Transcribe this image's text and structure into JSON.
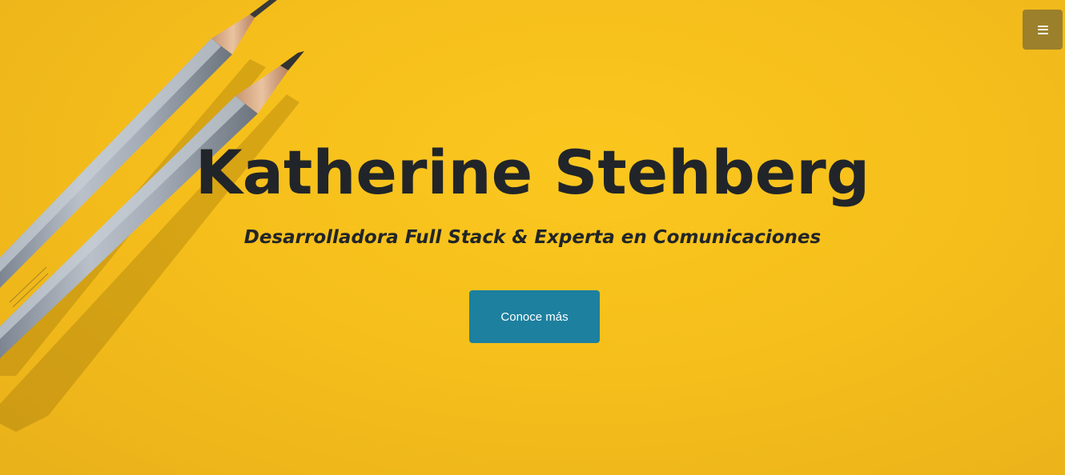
{
  "hero": {
    "title": "Katherine Stehberg",
    "subtitle": "Desarrolladora Full Stack & Experta en Comunicaciones",
    "cta_label": "Conoce más",
    "background_color": "#f6bf1b"
  },
  "nav": {
    "menu_icon": "hamburger-menu-icon"
  },
  "colors": {
    "accent": "#1d809f",
    "text": "#212529",
    "background": "#f6bf1b"
  }
}
